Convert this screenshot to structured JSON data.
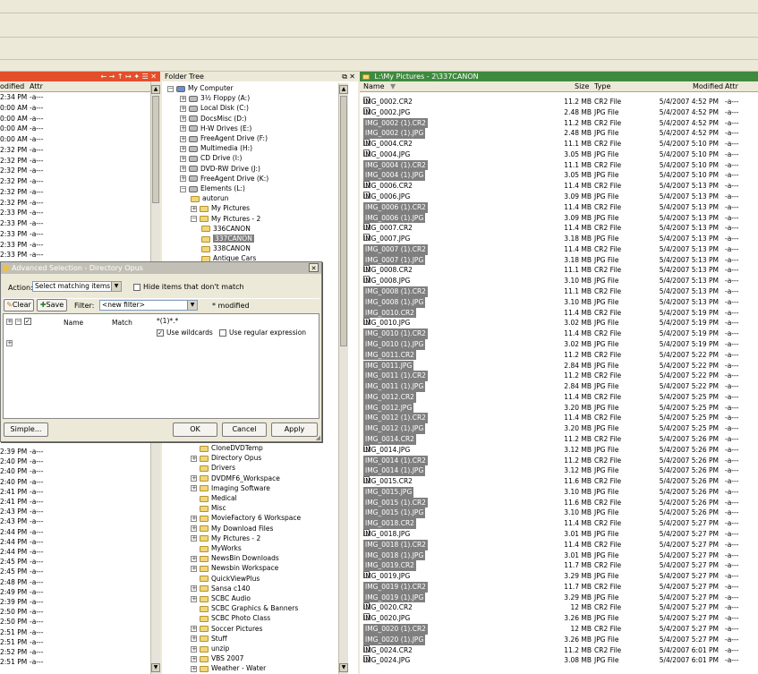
{
  "colors": {
    "left_header": "#e34f2b",
    "tree_header": "#ece9d8",
    "right_header": "#3e8a3e"
  },
  "left_pane": {
    "header_controls": "← → ↑ ↦ ✦ ☰ ✕",
    "columns": {
      "modified": "odified",
      "attr": "Attr"
    },
    "rows_top": [
      "2:34 PM",
      "0:00 AM",
      "0:00 AM",
      "0:00 AM",
      "0:00 AM",
      "2:32 PM",
      "2:32 PM",
      "2:32 PM",
      "2:32 PM",
      "2:32 PM",
      "2:32 PM",
      "2:33 PM",
      "2:33 PM",
      "2:33 PM",
      "2:33 PM",
      "2:33 PM"
    ],
    "rows_bottom": [
      "2:39 PM",
      "2:40 PM",
      "2:40 PM",
      "2:40 PM",
      "2:41 PM",
      "2:41 PM",
      "2:43 PM",
      "2:43 PM",
      "2:44 PM",
      "2:44 PM",
      "2:44 PM",
      "2:45 PM",
      "2:45 PM",
      "2:48 PM",
      "2:49 PM",
      "2:39 PM",
      "2:50 PM",
      "2:50 PM",
      "2:51 PM",
      "2:51 PM",
      "2:52 PM",
      "2:51 PM"
    ],
    "attr": "-a---"
  },
  "folder_tree": {
    "title": "Folder Tree",
    "items": [
      {
        "label": "My Computer",
        "level": 0,
        "kind": "computer"
      },
      {
        "label": "3½ Floppy (A:)",
        "level": 1,
        "kind": "drive"
      },
      {
        "label": "Local Disk (C:)",
        "level": 1,
        "kind": "drive"
      },
      {
        "label": "DocsMisc (D:)",
        "level": 1,
        "kind": "drive"
      },
      {
        "label": "H-W Drives (E:)",
        "level": 1,
        "kind": "drive"
      },
      {
        "label": "FreeAgent Drive (F:)",
        "level": 1,
        "kind": "drive"
      },
      {
        "label": "Multimedia (H:)",
        "level": 1,
        "kind": "drive"
      },
      {
        "label": "CD Drive (I:)",
        "level": 1,
        "kind": "drive"
      },
      {
        "label": "DVD-RW Drive (J:)",
        "level": 1,
        "kind": "drive"
      },
      {
        "label": "FreeAgent Drive (K:)",
        "level": 1,
        "kind": "drive"
      },
      {
        "label": "Elements (L:)",
        "level": 1,
        "kind": "drive"
      },
      {
        "label": "autorun",
        "level": 2,
        "kind": "folder"
      },
      {
        "label": "My Pictures",
        "level": 2,
        "kind": "folder"
      },
      {
        "label": "My Pictures - 2",
        "level": 2,
        "kind": "folder"
      },
      {
        "label": "336CANON",
        "level": 3,
        "kind": "folder"
      },
      {
        "label": "337CANON",
        "level": 3,
        "kind": "folder",
        "selected": true
      },
      {
        "label": "338CANON",
        "level": 3,
        "kind": "folder"
      },
      {
        "label": "Antique Cars",
        "level": 3,
        "kind": "folder"
      }
    ],
    "items_bottom": [
      "CloneDVDTemp",
      "Directory Opus",
      "Drivers",
      "DVDMF6_Workspace",
      "Imaging Software",
      "Medical",
      "Misc",
      "MovieFactory 6 Workspace",
      "My Download Files",
      "My Pictures - 2",
      "MyWorks",
      "NewsBin Downloads",
      "Newsbin Workspace",
      "QuickViewPlus",
      "Sansa c140",
      "SCBC Audio",
      "SCBC Graphics & Banners",
      "SCBC Photo Class",
      "Soccer Pictures",
      "Stuff",
      "unzip",
      "VBS 2007",
      "Weather - Water"
    ]
  },
  "right_pane": {
    "path": "L:\\My Pictures - 2\\337CANON",
    "columns": {
      "name": "Name",
      "size": "Size",
      "type": "Type",
      "modified": "Modified",
      "attr": "Attr"
    },
    "files": [
      {
        "name": "IMG_0002.CR2",
        "size": "11.2 MB",
        "type": "CR2 File",
        "mod": "5/4/2007 4:52 PM",
        "sel": false
      },
      {
        "name": "IMG_0002.JPG",
        "size": "2.48 MB",
        "type": "JPG File",
        "mod": "5/4/2007 4:52 PM",
        "sel": false
      },
      {
        "name": "IMG_0002 (1).CR2",
        "size": "11.2 MB",
        "type": "CR2 File",
        "mod": "5/4/2007 4:52 PM",
        "sel": true
      },
      {
        "name": "IMG_0002 (1).JPG",
        "size": "2.48 MB",
        "type": "JPG File",
        "mod": "5/4/2007 4:52 PM",
        "sel": true
      },
      {
        "name": "IMG_0004.CR2",
        "size": "11.1 MB",
        "type": "CR2 File",
        "mod": "5/4/2007 5:10 PM",
        "sel": false
      },
      {
        "name": "IMG_0004.JPG",
        "size": "3.05 MB",
        "type": "JPG File",
        "mod": "5/4/2007 5:10 PM",
        "sel": false
      },
      {
        "name": "IMG_0004 (1).CR2",
        "size": "11.1 MB",
        "type": "CR2 File",
        "mod": "5/4/2007 5:10 PM",
        "sel": true
      },
      {
        "name": "IMG_0004 (1).JPG",
        "size": "3.05 MB",
        "type": "JPG File",
        "mod": "5/4/2007 5:10 PM",
        "sel": true
      },
      {
        "name": "IMG_0006.CR2",
        "size": "11.4 MB",
        "type": "CR2 File",
        "mod": "5/4/2007 5:13 PM",
        "sel": false
      },
      {
        "name": "IMG_0006.JPG",
        "size": "3.09 MB",
        "type": "JPG File",
        "mod": "5/4/2007 5:13 PM",
        "sel": false
      },
      {
        "name": "IMG_0006 (1).CR2",
        "size": "11.4 MB",
        "type": "CR2 File",
        "mod": "5/4/2007 5:13 PM",
        "sel": true
      },
      {
        "name": "IMG_0006 (1).JPG",
        "size": "3.09 MB",
        "type": "JPG File",
        "mod": "5/4/2007 5:13 PM",
        "sel": true
      },
      {
        "name": "IMG_0007.CR2",
        "size": "11.4 MB",
        "type": "CR2 File",
        "mod": "5/4/2007 5:13 PM",
        "sel": false
      },
      {
        "name": "IMG_0007.JPG",
        "size": "3.18 MB",
        "type": "JPG File",
        "mod": "5/4/2007 5:13 PM",
        "sel": false
      },
      {
        "name": "IMG_0007 (1).CR2",
        "size": "11.4 MB",
        "type": "CR2 File",
        "mod": "5/4/2007 5:13 PM",
        "sel": true
      },
      {
        "name": "IMG_0007 (1).JPG",
        "size": "3.18 MB",
        "type": "JPG File",
        "mod": "5/4/2007 5:13 PM",
        "sel": true
      },
      {
        "name": "IMG_0008.CR2",
        "size": "11.1 MB",
        "type": "CR2 File",
        "mod": "5/4/2007 5:13 PM",
        "sel": false
      },
      {
        "name": "IMG_0008.JPG",
        "size": "3.10 MB",
        "type": "JPG File",
        "mod": "5/4/2007 5:13 PM",
        "sel": false
      },
      {
        "name": "IMG_0008 (1).CR2",
        "size": "11.1 MB",
        "type": "CR2 File",
        "mod": "5/4/2007 5:13 PM",
        "sel": true
      },
      {
        "name": "IMG_0008 (1).JPG",
        "size": "3.10 MB",
        "type": "JPG File",
        "mod": "5/4/2007 5:13 PM",
        "sel": true
      },
      {
        "name": "IMG_0010.CR2",
        "size": "11.4 MB",
        "type": "CR2 File",
        "mod": "5/4/2007 5:19 PM",
        "sel": true
      },
      {
        "name": "IMG_0010.JPG",
        "size": "3.02 MB",
        "type": "JPG File",
        "mod": "5/4/2007 5:19 PM",
        "sel": false
      },
      {
        "name": "IMG_0010 (1).CR2",
        "size": "11.4 MB",
        "type": "CR2 File",
        "mod": "5/4/2007 5:19 PM",
        "sel": true
      },
      {
        "name": "IMG_0010 (1).JPG",
        "size": "3.02 MB",
        "type": "JPG File",
        "mod": "5/4/2007 5:19 PM",
        "sel": true
      },
      {
        "name": "IMG_0011.CR2",
        "size": "11.2 MB",
        "type": "CR2 File",
        "mod": "5/4/2007 5:22 PM",
        "sel": true
      },
      {
        "name": "IMG_0011.JPG",
        "size": "2.84 MB",
        "type": "JPG File",
        "mod": "5/4/2007 5:22 PM",
        "sel": true
      },
      {
        "name": "IMG_0011 (1).CR2",
        "size": "11.2 MB",
        "type": "CR2 File",
        "mod": "5/4/2007 5:22 PM",
        "sel": true
      },
      {
        "name": "IMG_0011 (1).JPG",
        "size": "2.84 MB",
        "type": "JPG File",
        "mod": "5/4/2007 5:22 PM",
        "sel": true
      },
      {
        "name": "IMG_0012.CR2",
        "size": "11.4 MB",
        "type": "CR2 File",
        "mod": "5/4/2007 5:25 PM",
        "sel": true
      },
      {
        "name": "IMG_0012.JPG",
        "size": "3.20 MB",
        "type": "JPG File",
        "mod": "5/4/2007 5:25 PM",
        "sel": true
      },
      {
        "name": "IMG_0012 (1).CR2",
        "size": "11.4 MB",
        "type": "CR2 File",
        "mod": "5/4/2007 5:25 PM",
        "sel": true
      },
      {
        "name": "IMG_0012 (1).JPG",
        "size": "3.20 MB",
        "type": "JPG File",
        "mod": "5/4/2007 5:25 PM",
        "sel": true
      },
      {
        "name": "IMG_0014.CR2",
        "size": "11.2 MB",
        "type": "CR2 File",
        "mod": "5/4/2007 5:26 PM",
        "sel": true
      },
      {
        "name": "IMG_0014.JPG",
        "size": "3.12 MB",
        "type": "JPG File",
        "mod": "5/4/2007 5:26 PM",
        "sel": false
      },
      {
        "name": "IMG_0014 (1).CR2",
        "size": "11.2 MB",
        "type": "CR2 File",
        "mod": "5/4/2007 5:26 PM",
        "sel": true
      },
      {
        "name": "IMG_0014 (1).JPG",
        "size": "3.12 MB",
        "type": "JPG File",
        "mod": "5/4/2007 5:26 PM",
        "sel": true
      },
      {
        "name": "IMG_0015.CR2",
        "size": "11.6 MB",
        "type": "CR2 File",
        "mod": "5/4/2007 5:26 PM",
        "sel": false
      },
      {
        "name": "IMG_0015.JPG",
        "size": "3.10 MB",
        "type": "JPG File",
        "mod": "5/4/2007 5:26 PM",
        "sel": true
      },
      {
        "name": "IMG_0015 (1).CR2",
        "size": "11.6 MB",
        "type": "CR2 File",
        "mod": "5/4/2007 5:26 PM",
        "sel": true
      },
      {
        "name": "IMG_0015 (1).JPG",
        "size": "3.10 MB",
        "type": "JPG File",
        "mod": "5/4/2007 5:26 PM",
        "sel": true
      },
      {
        "name": "IMG_0018.CR2",
        "size": "11.4 MB",
        "type": "CR2 File",
        "mod": "5/4/2007 5:27 PM",
        "sel": true
      },
      {
        "name": "IMG_0018.JPG",
        "size": "3.01 MB",
        "type": "JPG File",
        "mod": "5/4/2007 5:27 PM",
        "sel": false
      },
      {
        "name": "IMG_0018 (1).CR2",
        "size": "11.4 MB",
        "type": "CR2 File",
        "mod": "5/4/2007 5:27 PM",
        "sel": true
      },
      {
        "name": "IMG_0018 (1).JPG",
        "size": "3.01 MB",
        "type": "JPG File",
        "mod": "5/4/2007 5:27 PM",
        "sel": true
      },
      {
        "name": "IMG_0019.CR2",
        "size": "11.7 MB",
        "type": "CR2 File",
        "mod": "5/4/2007 5:27 PM",
        "sel": true
      },
      {
        "name": "IMG_0019.JPG",
        "size": "3.29 MB",
        "type": "JPG File",
        "mod": "5/4/2007 5:27 PM",
        "sel": false
      },
      {
        "name": "IMG_0019 (1).CR2",
        "size": "11.7 MB",
        "type": "CR2 File",
        "mod": "5/4/2007 5:27 PM",
        "sel": true
      },
      {
        "name": "IMG_0019 (1).JPG",
        "size": "3.29 MB",
        "type": "JPG File",
        "mod": "5/4/2007 5:27 PM",
        "sel": true
      },
      {
        "name": "IMG_0020.CR2",
        "size": "12 MB",
        "type": "CR2 File",
        "mod": "5/4/2007 5:27 PM",
        "sel": false
      },
      {
        "name": "IMG_0020.JPG",
        "size": "3.26 MB",
        "type": "JPG File",
        "mod": "5/4/2007 5:27 PM",
        "sel": false
      },
      {
        "name": "IMG_0020 (1).CR2",
        "size": "12 MB",
        "type": "CR2 File",
        "mod": "5/4/2007 5:27 PM",
        "sel": true
      },
      {
        "name": "IMG_0020 (1).JPG",
        "size": "3.26 MB",
        "type": "JPG File",
        "mod": "5/4/2007 5:27 PM",
        "sel": true
      },
      {
        "name": "IMG_0024.CR2",
        "size": "11.2 MB",
        "type": "CR2 File",
        "mod": "5/4/2007 6:01 PM",
        "sel": false
      },
      {
        "name": "IMG_0024.JPG",
        "size": "3.08 MB",
        "type": "JPG File",
        "mod": "5/4/2007 6:01 PM",
        "sel": false
      }
    ]
  },
  "dialog": {
    "title": "Advanced Selection - Directory Opus",
    "close": "✕",
    "action_label": "Action:",
    "action_value": "Select matching items",
    "hide_label": "Hide items that don't match",
    "clear": "Clear",
    "save": "Save",
    "filter_label": "Filter:",
    "filter_value": "<new filter>",
    "modified_note": "* modified",
    "col_name": "Name",
    "col_match": "Match",
    "pattern": "*(1)*.*",
    "use_wildcards": "Use wildcards",
    "use_regex": "Use regular expression",
    "simple": "Simple...",
    "ok": "OK",
    "cancel": "Cancel",
    "apply": "Apply"
  }
}
